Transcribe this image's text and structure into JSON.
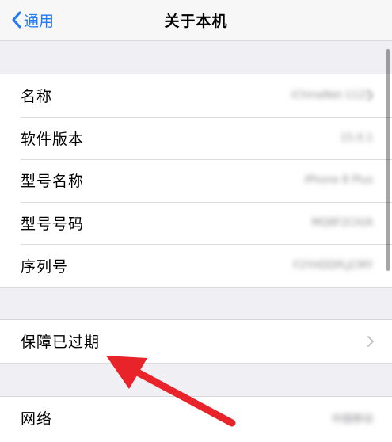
{
  "nav": {
    "back_label": "通用",
    "title": "关于本机"
  },
  "about": {
    "rows": [
      {
        "label": "名称",
        "value": "iChinaNet-1123"
      },
      {
        "label": "软件版本",
        "value": "15.0.1"
      },
      {
        "label": "型号名称",
        "value": "iPhone 8 Plus"
      },
      {
        "label": "型号号码",
        "value": "MQ8F2CH/A"
      },
      {
        "label": "序列号",
        "value": "F2YHDDPLJCMY"
      }
    ]
  },
  "warranty": {
    "label": "保障已过期"
  },
  "network": {
    "label": "网络",
    "value": "中国移动"
  },
  "colors": {
    "accent": "#1f7bf6",
    "annotation_arrow": "#e8232a"
  },
  "icons": {
    "back": "chevron-left-icon",
    "disclosure": "chevron-right-icon"
  }
}
